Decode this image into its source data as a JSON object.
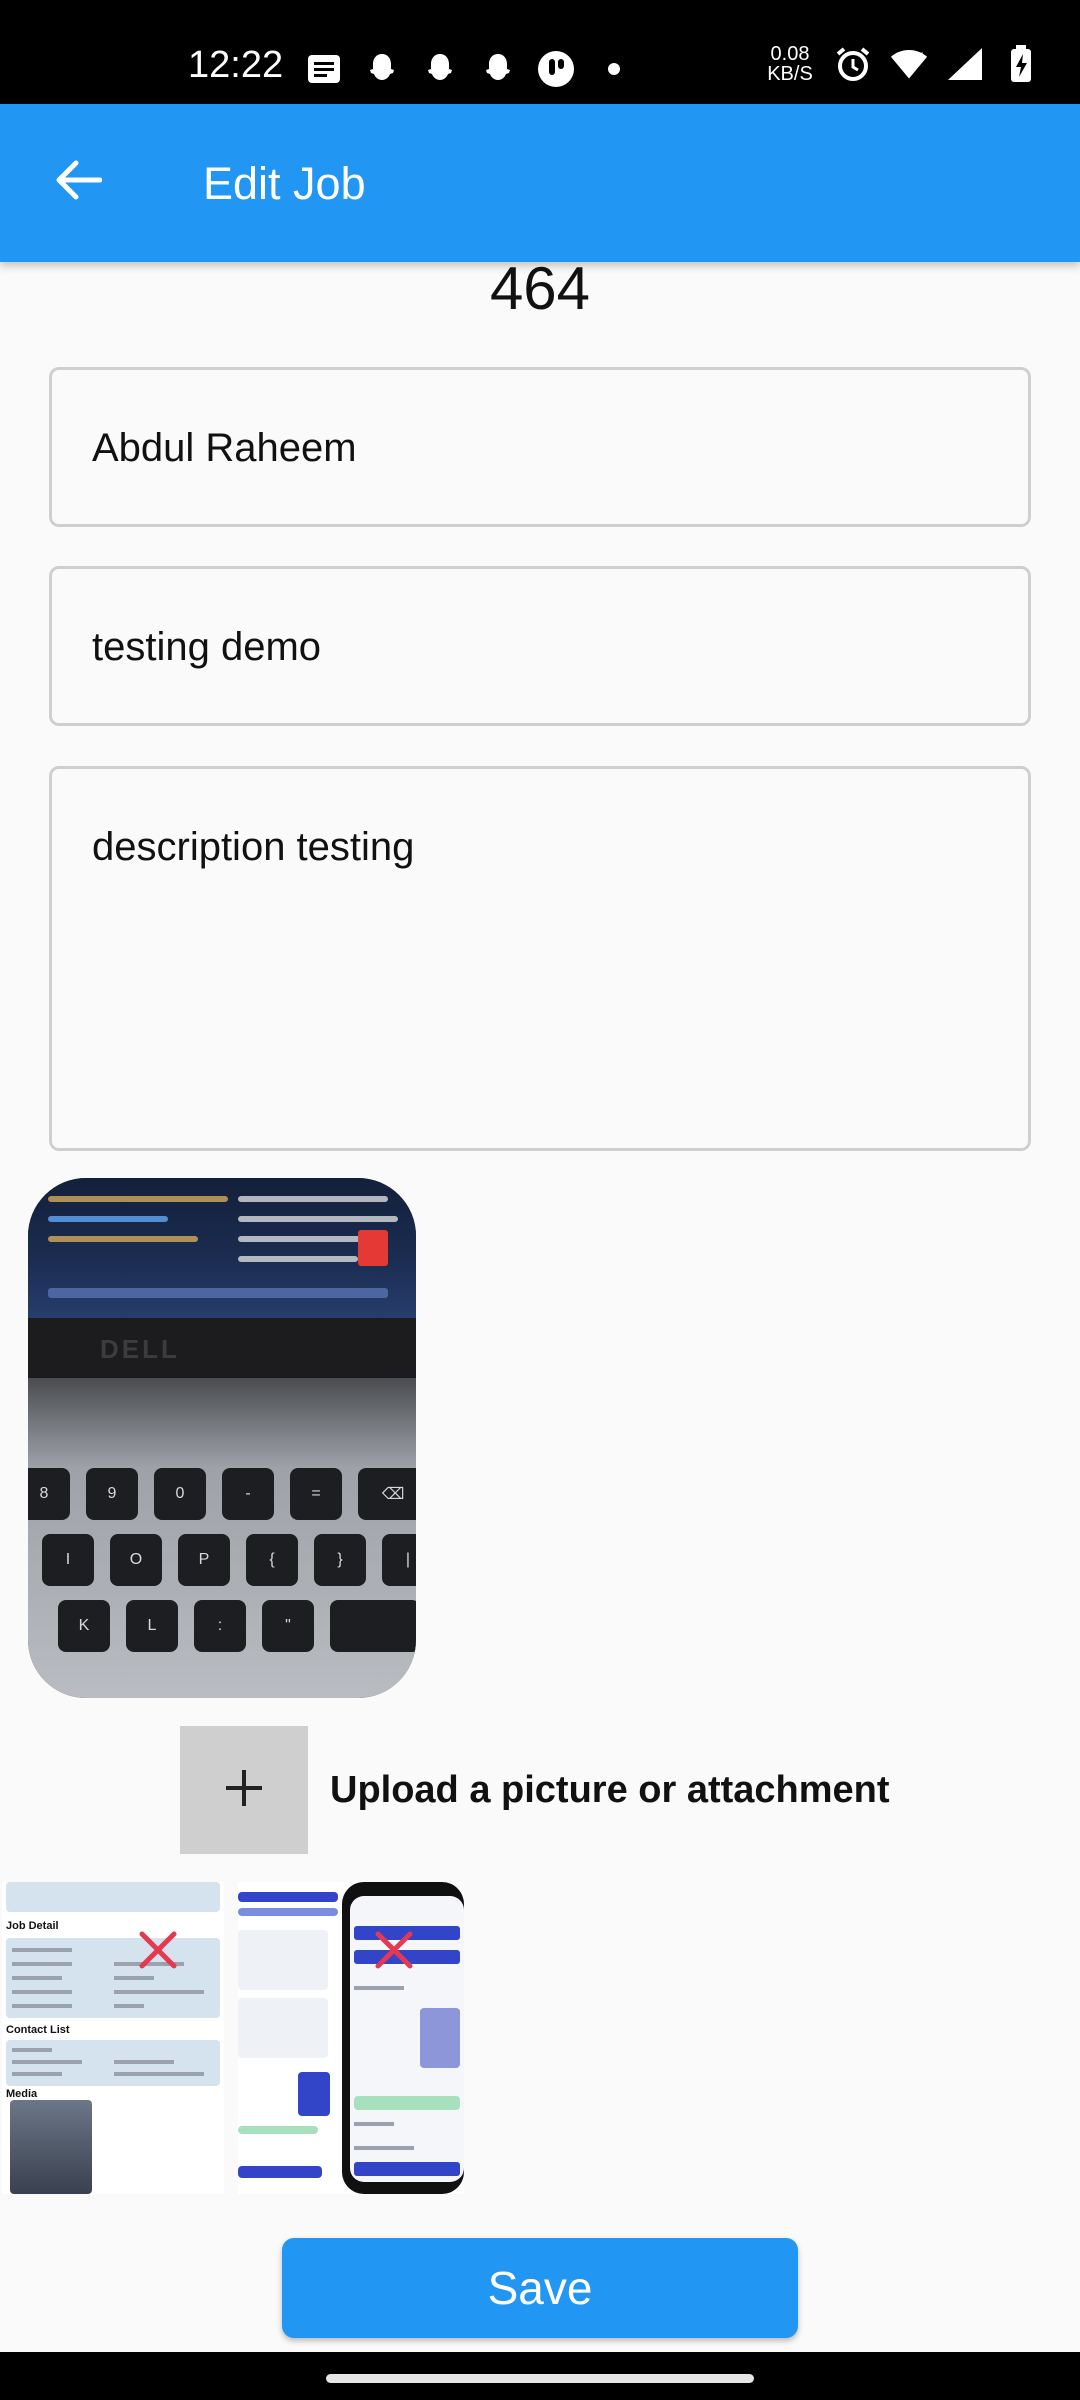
{
  "status_bar": {
    "time": "12:22",
    "net_speed_value": "0.08",
    "net_speed_unit": "KB/S",
    "left_icons": [
      "messages-icon",
      "snapchat-icon",
      "snapchat-icon",
      "snapchat-icon",
      "app-icon",
      "dot-icon"
    ],
    "right_icons": [
      "alarm-icon",
      "wifi-icon",
      "signal-icon",
      "battery-charging-icon"
    ]
  },
  "app_bar": {
    "title": "Edit Job",
    "back_icon": "arrow-back-icon",
    "color": "#2196f3"
  },
  "job": {
    "number": "464",
    "customer_name": "Abdul Raheem",
    "title": "testing demo",
    "description": "description testing"
  },
  "upload": {
    "label": "Upload a picture or attachment",
    "icon": "plus-icon"
  },
  "attachments": [
    {
      "name": "job-detail-screenshot",
      "remove_icon": "close-icon",
      "section_job_detail": "Job Detail",
      "section_contact_list": "Contact List",
      "section_media": "Media"
    },
    {
      "name": "app-screenshot",
      "remove_icon": "close-icon"
    }
  ],
  "actions": {
    "save_label": "Save"
  }
}
